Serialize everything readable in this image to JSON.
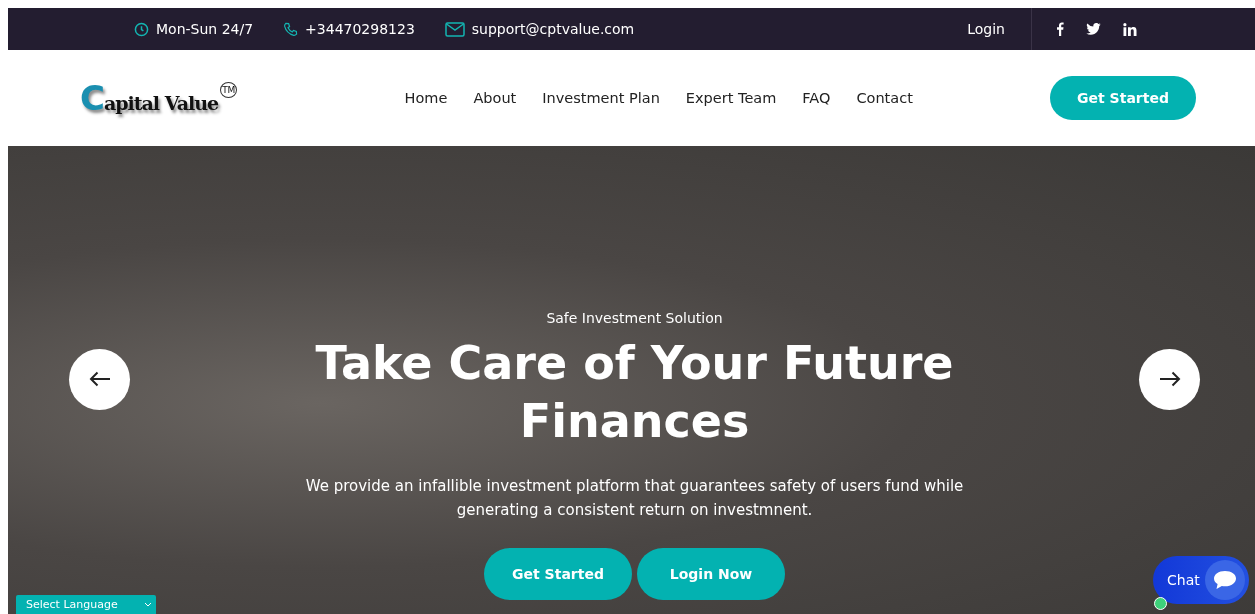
{
  "top_bar": {
    "hours": "Mon-Sun 24/7",
    "phone": "+34470298123",
    "email": "support@cptvalue.com",
    "login": "Login",
    "social": [
      {
        "kind": "facebook"
      },
      {
        "kind": "twitter"
      },
      {
        "kind": "linkedin"
      }
    ]
  },
  "header": {
    "logo": {
      "initial": "C",
      "rest": "apital Value",
      "mark": "TM"
    },
    "nav": [
      {
        "label": "Home"
      },
      {
        "label": "About"
      },
      {
        "label": "Investment Plan"
      },
      {
        "label": "Expert Team"
      },
      {
        "label": "FAQ"
      },
      {
        "label": "Contact"
      }
    ],
    "cta": "Get Started"
  },
  "hero": {
    "eyebrow": "Safe Investment Solution",
    "title": "Take Care of Your Future Finances",
    "text": "We provide an infallible investment platform that guarantees safety of users fund while generating a consistent return on investmnent.",
    "buttons": [
      "Get Started",
      "Login Now"
    ]
  },
  "language_select": {
    "value": "Select Language"
  },
  "chat": {
    "label": "Chat",
    "online": true
  }
}
